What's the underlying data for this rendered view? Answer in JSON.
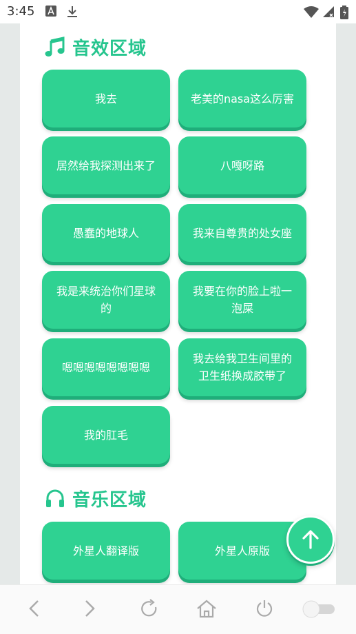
{
  "status_bar": {
    "time": "3:45",
    "icons": [
      "text-a-icon",
      "download-icon",
      "wifi-icon",
      "signal-icon",
      "battery-icon"
    ]
  },
  "sections": {
    "sound_effects": {
      "title": "音效区域",
      "icon": "music-note-icon",
      "buttons": [
        "我去",
        "老美的nasa这么厉害",
        "居然给我探测出来了",
        "八嘎呀路",
        "愚蠢的地球人",
        "我来自尊贵的处女座",
        "我是来统治你们星球的",
        "我要在你的脸上啦一泡屎",
        "嗯嗯嗯嗯嗯嗯嗯嗯",
        "我去给我卫生间里的卫生纸换成胶带了",
        "我的肛毛"
      ]
    },
    "music": {
      "title": "音乐区域",
      "icon": "headphones-icon",
      "buttons": [
        "外星人翻译版",
        "外星人原版"
      ]
    }
  },
  "fab": {
    "icon": "arrow-up-icon"
  },
  "bottom_nav": {
    "items": [
      "back-icon",
      "forward-icon",
      "refresh-icon",
      "home-icon",
      "power-icon",
      "toggle-switch"
    ]
  },
  "colors": {
    "accent": "#2fd292",
    "accent_dark": "#1fae7a",
    "title": "#26c58e",
    "page_bg": "#ffffff",
    "outer_bg": "#e5e9e8"
  }
}
